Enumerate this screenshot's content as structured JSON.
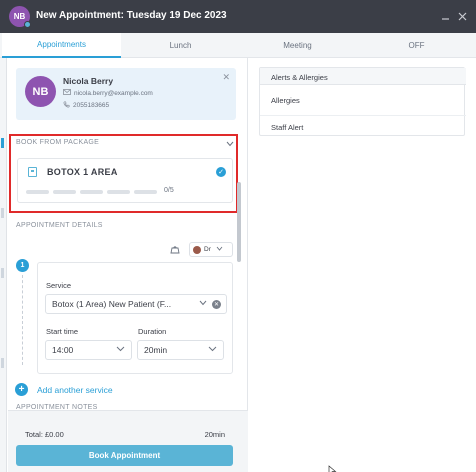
{
  "window": {
    "avatar_initials": "NB",
    "title": "New Appointment: Tuesday 19 Dec 2023"
  },
  "tabs": [
    {
      "label": "Appointments",
      "active": true
    },
    {
      "label": "Lunch",
      "active": false
    },
    {
      "label": "Meeting",
      "active": false
    },
    {
      "label": "OFF",
      "active": false
    }
  ],
  "client": {
    "initials": "NB",
    "name": "Nicola Berry",
    "email": "nicola.berry@example.com",
    "phone": "2055183665"
  },
  "package": {
    "section_label": "BOOK FROM PACKAGE",
    "name": "BOTOX 1 AREA",
    "used_count": 0,
    "total_count": 5,
    "count_text": "0/5"
  },
  "appointment": {
    "section_label": "APPOINTMENT DETAILS",
    "staff_label": "Dr",
    "step_number": "1",
    "service_label": "Service",
    "service_value": "Botox (1 Area) New Patient (F...",
    "start_time_label": "Start time",
    "start_time_value": "14:00",
    "duration_label": "Duration",
    "duration_value": "20min",
    "add_service_label": "Add another service",
    "notes_label": "APPOINTMENT NOTES"
  },
  "footer": {
    "total_text": "Total: £0.00",
    "duration_text": "20min",
    "book_button": "Book Appointment"
  },
  "alerts": {
    "title": "Alerts & Allergies",
    "items": [
      "Allergies",
      "Staff Alert"
    ]
  },
  "colors": {
    "accent": "#2a9fd6",
    "titlebar": "#3b3e47",
    "avatar": "#8e54b0",
    "highlight": "#e02a2a",
    "button": "#5ab4d6"
  }
}
